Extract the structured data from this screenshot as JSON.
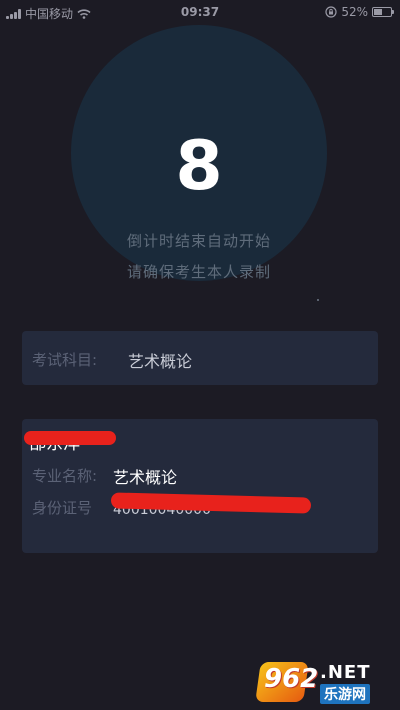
{
  "status_bar": {
    "carrier": "中国移动",
    "time": "09:37",
    "battery_percent": "52%",
    "battery_level": 0.52,
    "icons": [
      "signal-icon",
      "wifi-icon",
      "lock-rotation-icon",
      "battery-icon"
    ]
  },
  "countdown": {
    "number": "8",
    "line1": "倒计时结束自动开始",
    "line2": "请确保考生本人录制"
  },
  "subject": {
    "label": "考试科目:",
    "value": "艺术概论"
  },
  "student": {
    "name": "郜东洋",
    "major_label": "专业名称:",
    "major_value": "艺术概论",
    "id_label": "身份证号",
    "id_value": "40010040000"
  },
  "watermark": {
    "digits": "962",
    "net": ".NET",
    "site": "乐游网"
  },
  "colors": {
    "background": "#1c1b24",
    "circle": "#1a2a3a",
    "card": "#242a3c",
    "redaction": "#e8221c"
  }
}
